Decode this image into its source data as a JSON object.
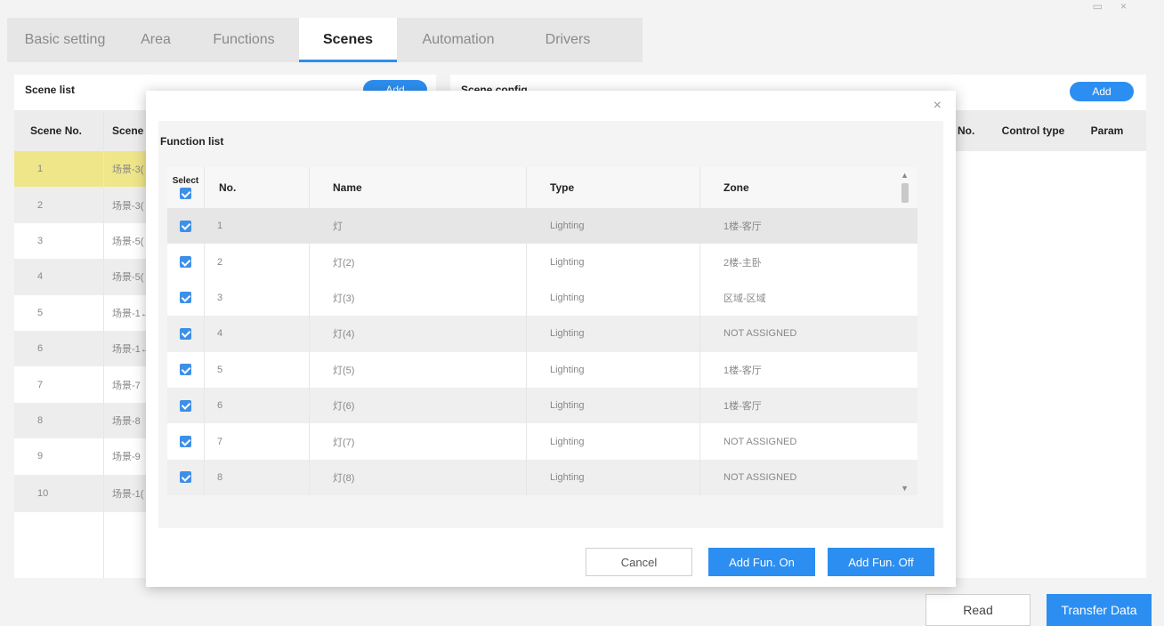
{
  "tabs": [
    {
      "label": "Basic setting",
      "active": false
    },
    {
      "label": "Area",
      "active": false
    },
    {
      "label": "Functions",
      "active": false
    },
    {
      "label": "Scenes",
      "active": true
    },
    {
      "label": "Automation",
      "active": false
    },
    {
      "label": "Drivers",
      "active": false
    }
  ],
  "scene_list": {
    "title": "Scene list",
    "add_label": "Add",
    "col_no": "Scene No.",
    "col_name": "Scene",
    "rows": [
      {
        "no": "1",
        "name": "场景-3("
      },
      {
        "no": "2",
        "name": "场景-3("
      },
      {
        "no": "3",
        "name": "场景-5("
      },
      {
        "no": "4",
        "name": "场景-5("
      },
      {
        "no": "5",
        "name": "场景-1←"
      },
      {
        "no": "6",
        "name": "场景-1←"
      },
      {
        "no": "7",
        "name": "场景-7"
      },
      {
        "no": "8",
        "name": "场景-8"
      },
      {
        "no": "9",
        "name": "场景-9"
      },
      {
        "no": "10",
        "name": "场景-1("
      }
    ]
  },
  "scene_config": {
    "title": "Scene config",
    "add_label": "Add",
    "col_no": "No.",
    "col_control": "Control type",
    "col_param": "Param"
  },
  "dialog": {
    "title": "Function list",
    "close": "×",
    "columns": {
      "select": "Select",
      "no": "No.",
      "name": "Name",
      "type": "Type",
      "zone": "Zone"
    },
    "rows": [
      {
        "no": "1",
        "name": "灯",
        "type": "Lighting",
        "zone": "1楼-客厅"
      },
      {
        "no": "2",
        "name": "灯(2)",
        "type": "Lighting",
        "zone": "2楼-主卧"
      },
      {
        "no": "3",
        "name": "灯(3)",
        "type": "Lighting",
        "zone": "区域-区域"
      },
      {
        "no": "4",
        "name": "灯(4)",
        "type": "Lighting",
        "zone": "NOT ASSIGNED"
      },
      {
        "no": "5",
        "name": "灯(5)",
        "type": "Lighting",
        "zone": "1楼-客厅"
      },
      {
        "no": "6",
        "name": "灯(6)",
        "type": "Lighting",
        "zone": "1楼-客厅"
      },
      {
        "no": "7",
        "name": "灯(7)",
        "type": "Lighting",
        "zone": "NOT ASSIGNED"
      },
      {
        "no": "8",
        "name": "灯(8)",
        "type": "Lighting",
        "zone": "NOT ASSIGNED"
      }
    ],
    "cancel_label": "Cancel",
    "add_on_label": "Add Fun. On",
    "add_off_label": "Add Fun. Off"
  },
  "footer": {
    "read_label": "Read",
    "transfer_label": "Transfer Data"
  },
  "colors": {
    "accent": "#2c8ef0",
    "selected_row": "#efe68a"
  }
}
